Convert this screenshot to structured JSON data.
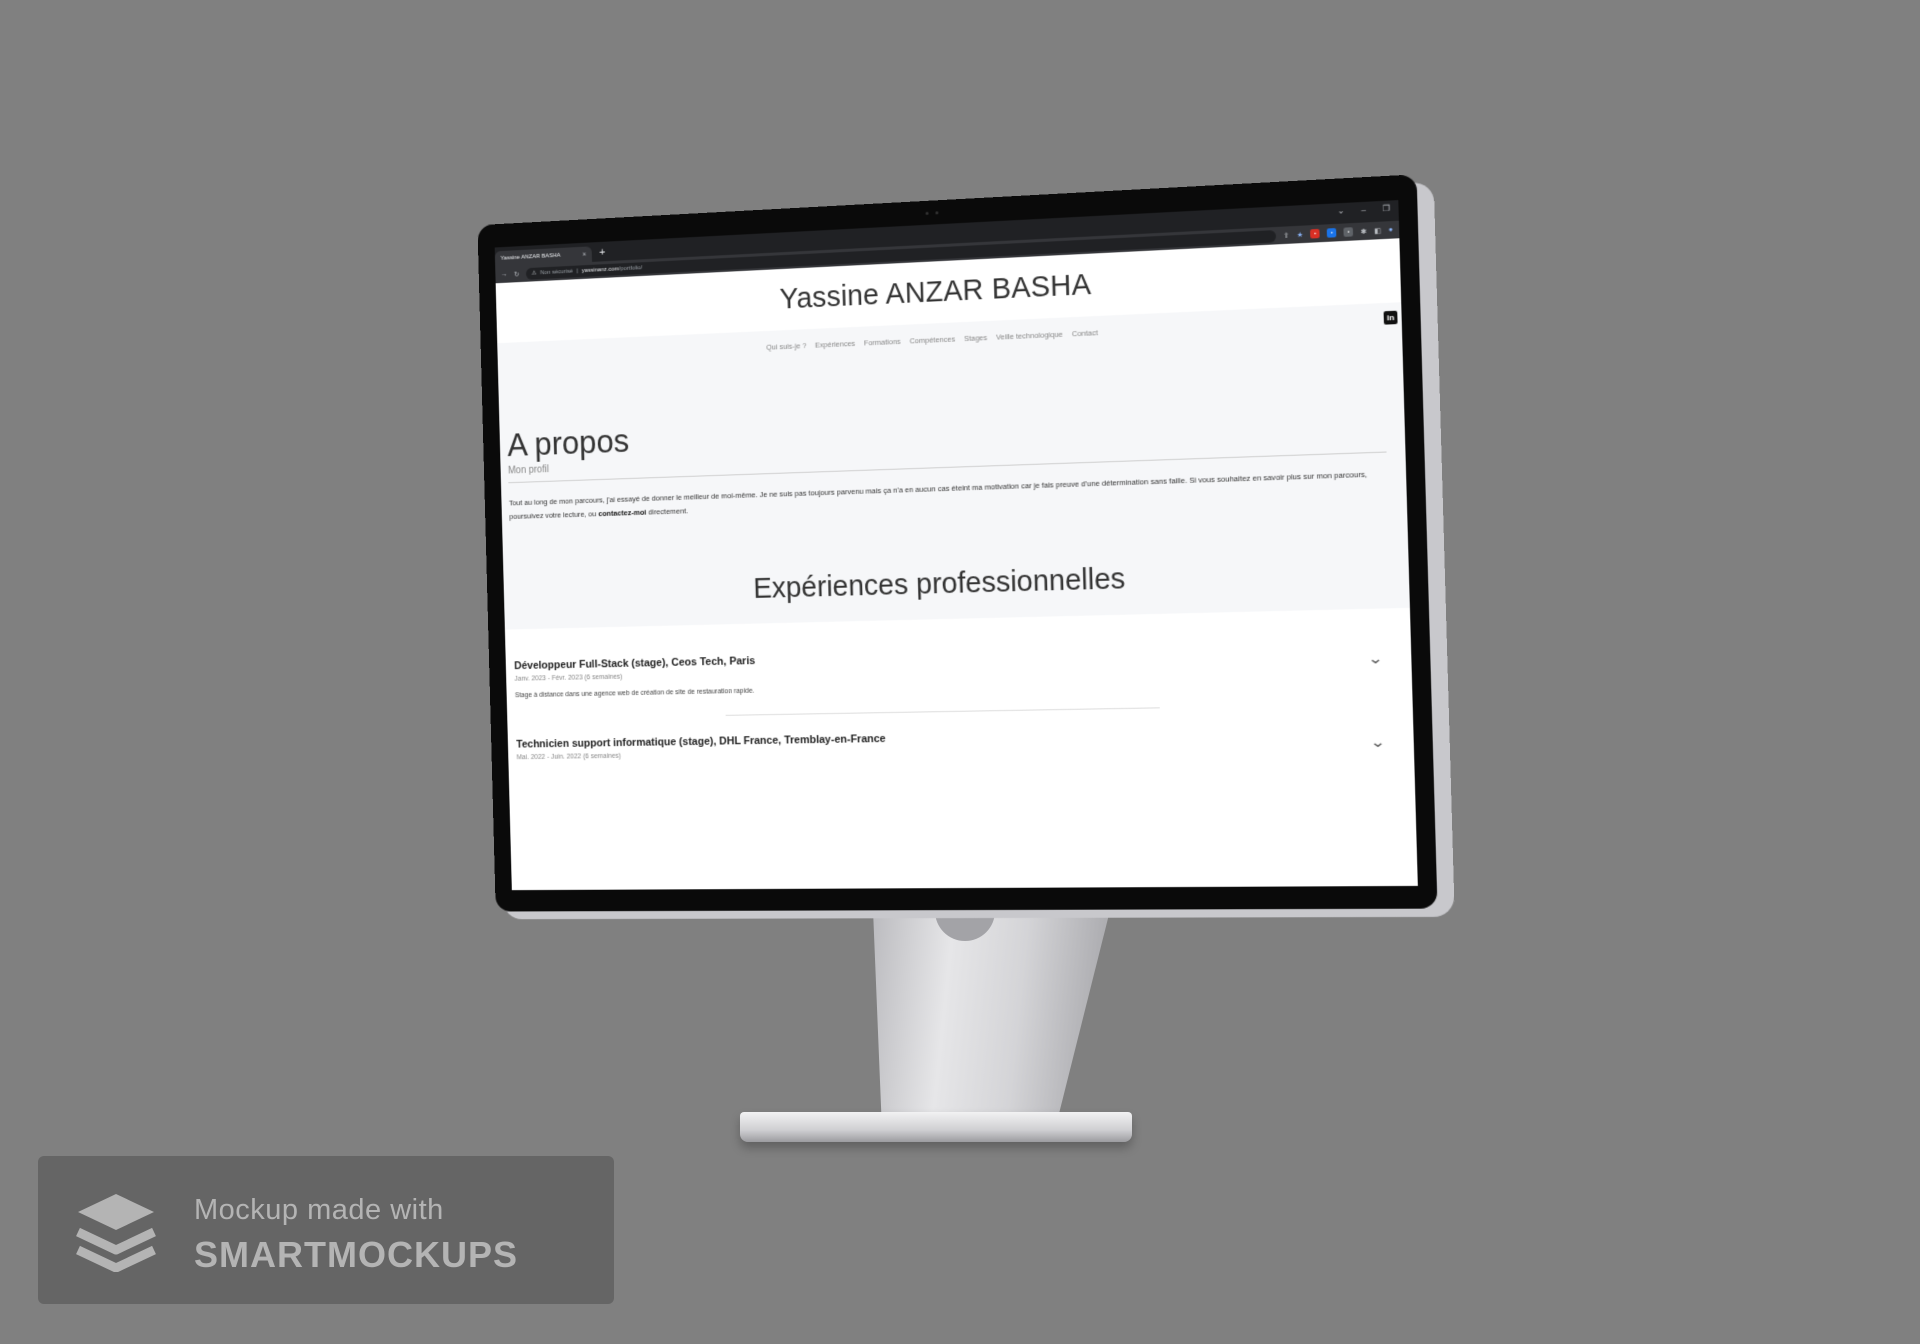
{
  "browser": {
    "tab_title": "Yassine ANZAR BASHA",
    "tab_close": "×",
    "new_tab": "+",
    "security_icon": "⚠",
    "security_text": "Non sécurisé",
    "url_host": "yassinanz.com",
    "url_path": "/portfolio/",
    "icons": [
      "back-arrow-icon",
      "reload-icon",
      "share-icon",
      "star-icon",
      "extensions-icon",
      "profile-icon"
    ]
  },
  "site": {
    "title": "Yassine ANZAR BASHA",
    "linkedin": "in",
    "nav": [
      "Qui suis-je ?",
      "Expériences",
      "Formations",
      "Compétences",
      "Stages",
      "Veille technologique",
      "Contact"
    ]
  },
  "about": {
    "title": "A propos",
    "subtitle": "Mon profil",
    "text_before": "Tout au long de mon parcours, j'ai essayé de donner le meilleur de moi-même. Je ne suis pas toujours parvenu mais ça n'a en aucun cas éteint ma motivation car je fais preuve d'une détermination sans faille. Si vous souhaitez en savoir plus sur mon parcours, poursuivez votre lecture, ou ",
    "contact_link": "contactez-moi",
    "text_after": " directement."
  },
  "experiences": {
    "title": "Expériences professionnelles",
    "items": [
      {
        "name": "Développeur Full-Stack (stage), Ceos Tech, Paris",
        "dates": "Janv. 2023 - Févr. 2023 (6 semaines)",
        "desc": "Stage à distance dans une agence web de création de site de restauration rapide."
      },
      {
        "name": "Technicien support informatique (stage), DHL France, Tremblay-en-France",
        "dates": "Mai. 2022 - Juin. 2022 (6 semaines)",
        "desc": ""
      }
    ]
  },
  "watermark": {
    "line1": "Mockup made with",
    "line2": "SMARTMOCKUPS"
  }
}
